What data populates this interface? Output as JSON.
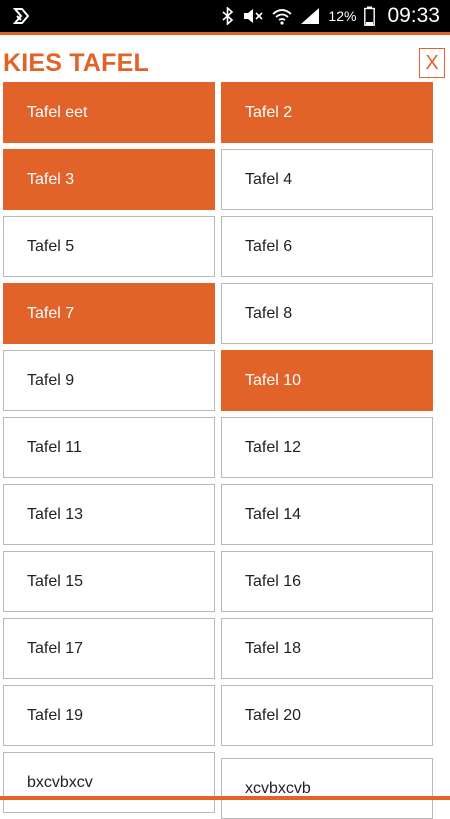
{
  "status_bar": {
    "time": "09:33",
    "battery": "12%",
    "icons": [
      "notification-icon",
      "bluetooth-icon",
      "mute-icon",
      "wifi-icon",
      "signal-icon",
      "battery-icon"
    ]
  },
  "colors": {
    "accent": "#e2632a",
    "tile_border": "#b9b9b9",
    "text_dark": "#222222"
  },
  "header": {
    "title": "KIES TAFEL",
    "close_label": "X"
  },
  "tables": [
    {
      "label": "Tafel eet",
      "selected": true
    },
    {
      "label": "Tafel 2",
      "selected": true
    },
    {
      "label": "Tafel 3",
      "selected": true
    },
    {
      "label": "Tafel 4",
      "selected": false
    },
    {
      "label": "Tafel 5",
      "selected": false
    },
    {
      "label": "Tafel 6",
      "selected": false
    },
    {
      "label": "Tafel 7",
      "selected": true
    },
    {
      "label": "Tafel 8",
      "selected": false
    },
    {
      "label": "Tafel 9",
      "selected": false
    },
    {
      "label": "Tafel 10",
      "selected": true
    },
    {
      "label": "Tafel 11",
      "selected": false
    },
    {
      "label": "Tafel 12",
      "selected": false
    },
    {
      "label": "Tafel 13",
      "selected": false
    },
    {
      "label": "Tafel 14",
      "selected": false
    },
    {
      "label": "Tafel 15",
      "selected": false
    },
    {
      "label": "Tafel 16",
      "selected": false
    },
    {
      "label": "Tafel 17",
      "selected": false
    },
    {
      "label": "Tafel 18",
      "selected": false
    },
    {
      "label": "Tafel 19",
      "selected": false
    },
    {
      "label": "Tafel 20",
      "selected": false
    },
    {
      "label": "bxcvbxcv",
      "selected": false
    },
    {
      "label": "xcvbxcvb",
      "selected": false
    }
  ]
}
